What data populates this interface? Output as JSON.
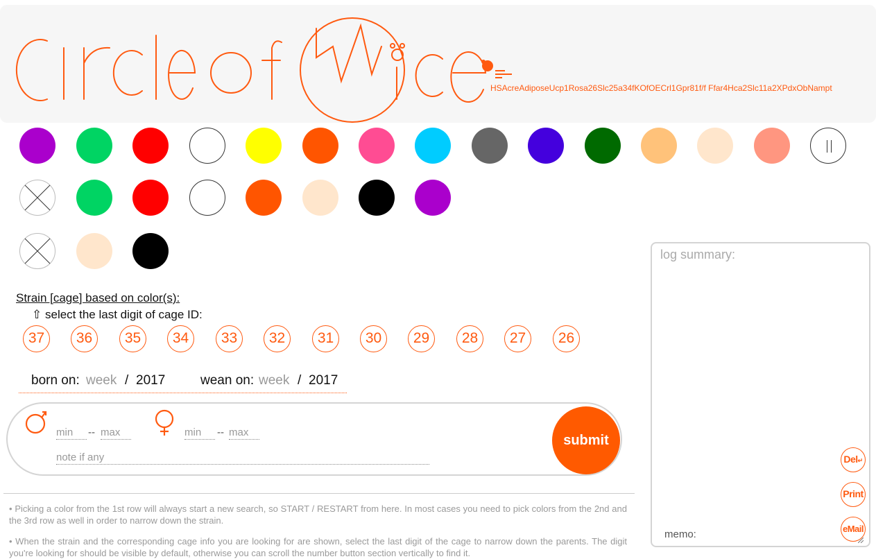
{
  "header": {
    "logo_text": "Circle of Mice",
    "strain_code": "HSAcreAdiposeUcp1Rosa26Slc25a34fKOfOECrl1Gpr81f/f Ffar4Hca2Slc11a2XPdxObNampt",
    "brand_color": "#ff5a10"
  },
  "color_rows": {
    "row1": [
      "#aa00cc",
      "#00d463",
      "#ff0000",
      "#ffffff",
      "#ffff00",
      "#ff5500",
      "#ff4c93",
      "#00ccff",
      "#666666",
      "#4400dd",
      "#006a00",
      "#ffc27a",
      "#ffe6cc",
      "#ff9680",
      "pause-icon"
    ],
    "row2": [
      "clear-icon",
      "#00d463",
      "#ff0000",
      "#ffffff",
      "#ff5500",
      "#ffe6cc",
      "#000000",
      "#aa00cc"
    ],
    "row3": [
      "clear-icon",
      "#ffe6cc",
      "#000000"
    ]
  },
  "strain": {
    "heading": "Strain [cage] based on color(s):",
    "hint_icon": "⇧",
    "hint": "select the last digit of cage ID:",
    "cage_digits": [
      "37",
      "36",
      "35",
      "34",
      "33",
      "32",
      "31",
      "30",
      "29",
      "28",
      "27",
      "26"
    ]
  },
  "dates": {
    "born_label": "born on:",
    "born_week_placeholder": "week",
    "born_slash": "/",
    "born_year": "2017",
    "wean_label": "wean on:",
    "wean_week_placeholder": "week",
    "wean_slash": "/",
    "wean_year": "2017"
  },
  "sex_panel": {
    "male_min": "min",
    "male_sep": "--",
    "male_max": "max",
    "female_min": "min",
    "female_sep": "--",
    "female_max": "max",
    "note_placeholder": "note if any",
    "submit_label": "submit"
  },
  "instructions": [
    "• Picking a color from the 1st row will always start a new search, so START / RESTART from here. In most cases you need to pick colors from the 2nd and the 3rd row as well in order to narrow down the strain.",
    "• When the strain and the corresponding cage info you are looking for are shown, select the last digit of the cage to narrow down the parents. The digit you're looking for should be visible by default, otherwise you can scroll the number button section vertically to find it."
  ],
  "log": {
    "title": "log summary:",
    "memo_label": "memo:",
    "del_label": "Del",
    "del_icon": "↵",
    "print_label": "Print",
    "email_label": "eMail"
  }
}
